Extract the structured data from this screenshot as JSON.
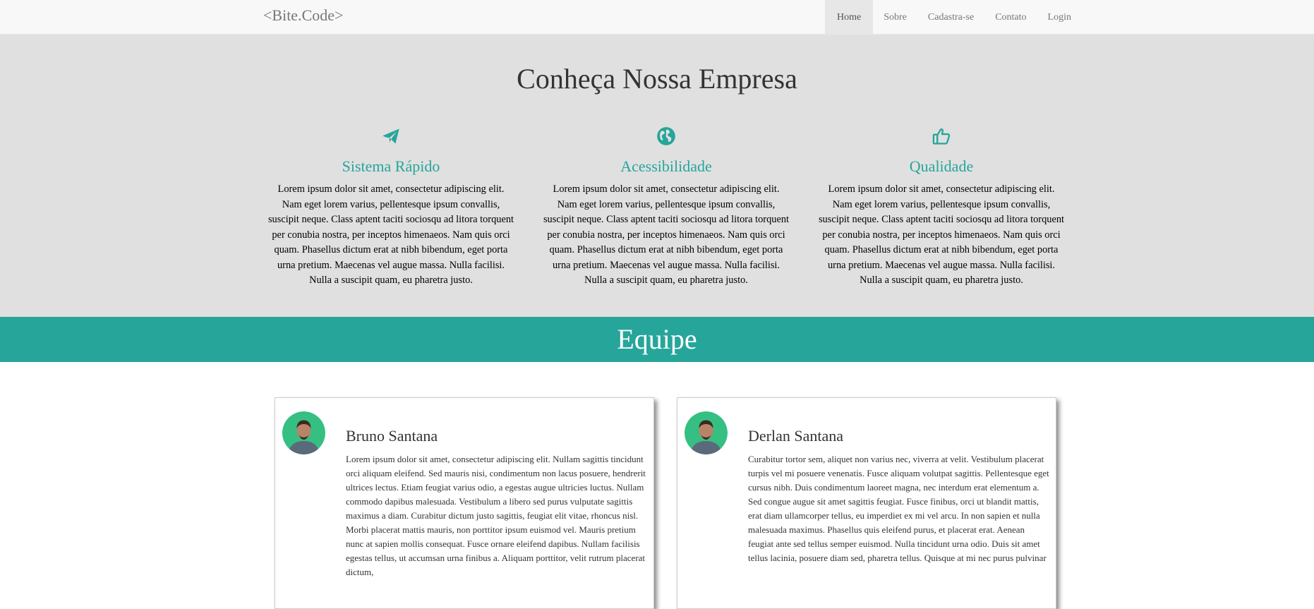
{
  "navbar": {
    "brand": "<Bite.Code>",
    "items": [
      {
        "label": "Home",
        "active": true
      },
      {
        "label": "Sobre",
        "active": false
      },
      {
        "label": "Cadastra-se",
        "active": false
      },
      {
        "label": "Contato",
        "active": false
      },
      {
        "label": "Login",
        "active": false
      }
    ]
  },
  "about": {
    "title": "Conheça Nossa Empresa",
    "features": [
      {
        "icon": "paper-plane-icon",
        "title": "Sistema Rápido",
        "text": "Lorem ipsum dolor sit amet, consectetur adipiscing elit. Nam eget lorem varius, pellentesque ipsum convallis, suscipit neque. Class aptent taciti sociosqu ad litora torquent per conubia nostra, per inceptos himenaeos. Nam quis orci quam. Phasellus dictum erat at nibh bibendum, eget porta urna pretium. Maecenas vel augue massa. Nulla facilisi. Nulla a suscipit quam, eu pharetra justo."
      },
      {
        "icon": "globe-icon",
        "title": "Acessibilidade",
        "text": "Lorem ipsum dolor sit amet, consectetur adipiscing elit. Nam eget lorem varius, pellentesque ipsum convallis, suscipit neque. Class aptent taciti sociosqu ad litora torquent per conubia nostra, per inceptos himenaeos. Nam quis orci quam. Phasellus dictum erat at nibh bibendum, eget porta urna pretium. Maecenas vel augue massa. Nulla facilisi. Nulla a suscipit quam, eu pharetra justo."
      },
      {
        "icon": "thumbs-up-icon",
        "title": "Qualidade",
        "text": "Lorem ipsum dolor sit amet, consectetur adipiscing elit. Nam eget lorem varius, pellentesque ipsum convallis, suscipit neque. Class aptent taciti sociosqu ad litora torquent per conubia nostra, per inceptos himenaeos. Nam quis orci quam. Phasellus dictum erat at nibh bibendum, eget porta urna pretium. Maecenas vel augue massa. Nulla facilisi. Nulla a suscipit quam, eu pharetra justo."
      }
    ]
  },
  "team": {
    "title": "Equipe",
    "members": [
      {
        "name": "Bruno Santana",
        "text": "Lorem ipsum dolor sit amet, consectetur adipiscing elit. Nullam sagittis tincidunt orci aliquam eleifend. Sed mauris nisi, condimentum non lacus posuere, hendrerit ultrices lectus. Etiam feugiat varius odio, a egestas augue ultricies luctus. Nullam commodo dapibus malesuada. Vestibulum a libero sed purus vulputate sagittis maximus a diam. Curabitur dictum justo sagittis, feugiat elit vitae, rhoncus nisl. Morbi placerat mattis mauris, non porttitor ipsum euismod vel. Mauris pretium nunc at sapien mollis consequat. Fusce ornare eleifend dapibus. Nullam facilisis egestas tellus, ut accumsan urna finibus a. Aliquam porttitor, velit rutrum placerat dictum,"
      },
      {
        "name": "Derlan Santana",
        "text": "Curabitur tortor sem, aliquet non varius nec, viverra at velit. Vestibulum placerat turpis vel mi posuere venenatis. Fusce aliquam volutpat sagittis. Pellentesque eget cursus nibh. Duis condimentum laoreet magna, nec interdum erat elementum a. Sed congue augue sit amet sagittis feugiat. Fusce finibus, orci ut blandit mattis, erat diam ullamcorper tellus, eu imperdiet ex mi vel arcu. In non sapien et nulla malesuada maximus. Phasellus quis eleifend purus, et placerat erat. Aenean feugiat ante sed tellus semper euismod. Nulla tincidunt urna odio. Duis sit amet tellus lacinia, posuere diam sed, pharetra tellus. Quisque at mi nec purus pulvinar"
      }
    ]
  },
  "colors": {
    "accent": "#26a69a",
    "navbar_bg": "#f8f8f8",
    "about_bg": "#e0e0e0"
  }
}
